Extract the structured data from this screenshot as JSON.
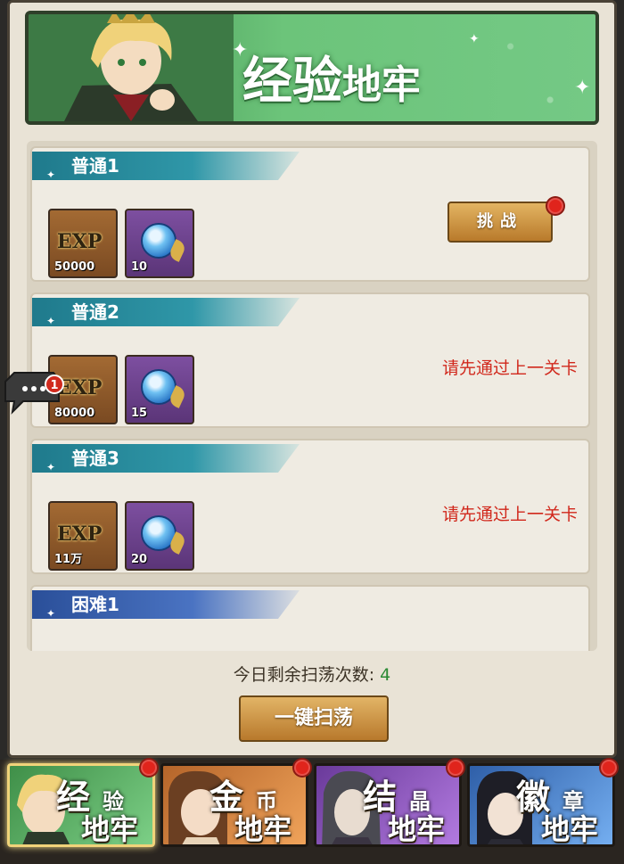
{
  "header": {
    "title_big_1": "经",
    "title_big_2": "验",
    "title_small": "地牢"
  },
  "stages": [
    {
      "name": "普通1",
      "difficulty": "normal",
      "rewards": [
        {
          "type": "exp",
          "label": "EXP",
          "qty": "50000"
        },
        {
          "type": "orb",
          "qty": "10"
        }
      ],
      "action": {
        "kind": "button",
        "label": "挑战",
        "red_dot": true
      }
    },
    {
      "name": "普通2",
      "difficulty": "normal",
      "rewards": [
        {
          "type": "exp",
          "label": "EXP",
          "qty": "80000"
        },
        {
          "type": "orb",
          "qty": "15"
        }
      ],
      "action": {
        "kind": "locked",
        "label": "请先通过上一关卡"
      }
    },
    {
      "name": "普通3",
      "difficulty": "normal",
      "rewards": [
        {
          "type": "exp",
          "label": "EXP",
          "qty": "11万"
        },
        {
          "type": "orb",
          "qty": "20"
        }
      ],
      "action": {
        "kind": "locked",
        "label": "请先通过上一关卡"
      }
    },
    {
      "name": "困难1",
      "difficulty": "hard"
    }
  ],
  "chat": {
    "badge": "1"
  },
  "sweep": {
    "remaining_label": "今日剩余扫荡次数:",
    "remaining_count": "4",
    "button_label": "一键扫荡"
  },
  "dungeon_tabs": [
    {
      "big": "经",
      "small": "验",
      "sub": "地牢",
      "active": true,
      "red_dot": true,
      "color": "#5fb86a"
    },
    {
      "big": "金",
      "small": "币",
      "sub": "地牢",
      "active": false,
      "red_dot": true,
      "color": "#d98a3c"
    },
    {
      "big": "结",
      "small": "晶",
      "sub": "地牢",
      "active": false,
      "red_dot": true,
      "color": "#9a5ad0"
    },
    {
      "big": "徽",
      "small": "章",
      "sub": "地牢",
      "active": false,
      "red_dot": true,
      "color": "#4f8fdc"
    }
  ],
  "colors": {
    "locked_text": "#d1281c",
    "sweep_count": "#2a8a33",
    "normal_tab": "#1f7a8c",
    "hard_tab": "#2a4f99"
  }
}
